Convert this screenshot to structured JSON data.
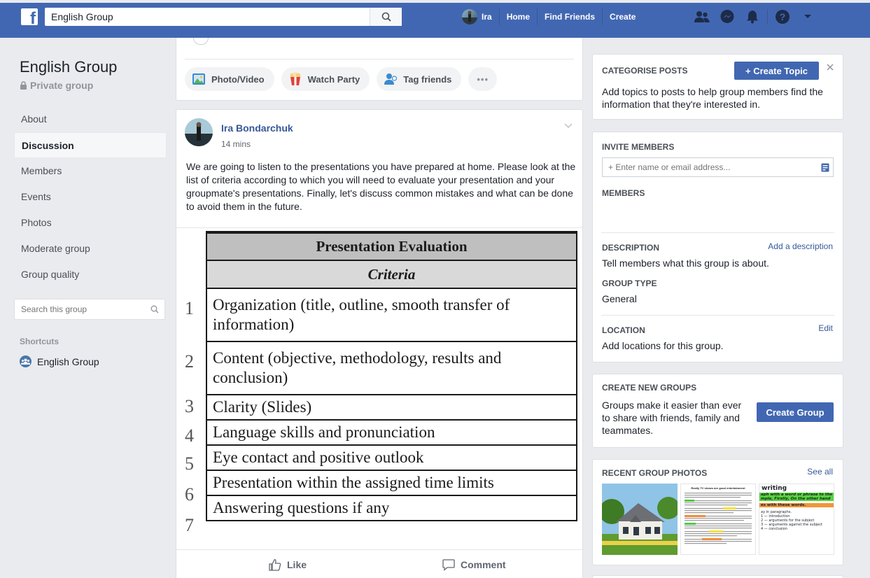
{
  "topbar": {
    "logo_letter": "f",
    "search_value": "English Group",
    "profile_name": "Ira",
    "nav": [
      "Home",
      "Find Friends",
      "Create"
    ]
  },
  "left": {
    "group_name": "English Group",
    "privacy": "Private group",
    "nav": [
      "About",
      "Discussion",
      "Members",
      "Events",
      "Photos",
      "Moderate group",
      "Group quality"
    ],
    "search_placeholder": "Search this group",
    "shortcuts_label": "Shortcuts",
    "shortcut_item": "English Group"
  },
  "composer": {
    "chips": [
      "Photo/Video",
      "Watch Party",
      "Tag friends"
    ],
    "more": "•••"
  },
  "post": {
    "author": "Ira Bondarchuk",
    "time": "14 mins",
    "text": "We are going to listen to the presentations you have prepared at home. Please look at the list of criteria according to which you will need to evaluate your presentation and your groupmate's presentations. Finally, let's discuss common mistakes and what can be done to avoid them in the future.",
    "image": {
      "title": "Presentation Evaluation",
      "subtitle": "Criteria",
      "rows": [
        {
          "num": "1",
          "text": "Organization (title, outline, smooth transfer of information)"
        },
        {
          "num": "2",
          "text": "Content (objective, methodology, results and conclusion)"
        },
        {
          "num": "3",
          "text": "Clarity (Slides)"
        },
        {
          "num": "4",
          "text": "Language skills and pronunciation"
        },
        {
          "num": "5",
          "text": "Eye contact and positive outlook"
        },
        {
          "num": "6",
          "text": "Presentation within the assigned time limits"
        },
        {
          "num": "7",
          "text": "Answering questions if any"
        }
      ]
    },
    "like": "Like",
    "comment": "Comment"
  },
  "right": {
    "categorise": {
      "title": "CATEGORISE POSTS",
      "button": "+ Create Topic",
      "text": "Add topics to posts to help group members find the information that they're interested in."
    },
    "invite": {
      "title": "INVITE MEMBERS",
      "placeholder": "+ Enter name or email address...",
      "members_title": "MEMBERS",
      "description_title": "DESCRIPTION",
      "description_link": "Add a description",
      "description_text": "Tell members what this group is about.",
      "type_title": "GROUP TYPE",
      "type_value": "General",
      "location_title": "LOCATION",
      "location_link": "Edit",
      "location_text": "Add locations for this group."
    },
    "create_groups": {
      "title": "CREATE NEW GROUPS",
      "text": "Groups make it easier than ever to share with friends, family and teammates.",
      "button": "Create Group"
    },
    "photos": {
      "title": "RECENT GROUP PHOTOS",
      "link": "See all",
      "thumb2_heading": "Really TV shows are good entertainment",
      "thumb3_heading": "writing",
      "thumb3_lines": [
        "aph with a word or phrase to the",
        "mple, Firstly, On the other hand",
        "es with these words.",
        "ay in paragraphs.",
        "1 — introduction",
        "2 — arguments for the subject",
        "3 — arguments against the subject",
        "4 — conclusion"
      ]
    }
  },
  "colors": {
    "brand": "#4267b2",
    "link": "#365899",
    "background": "#e9ebee"
  }
}
